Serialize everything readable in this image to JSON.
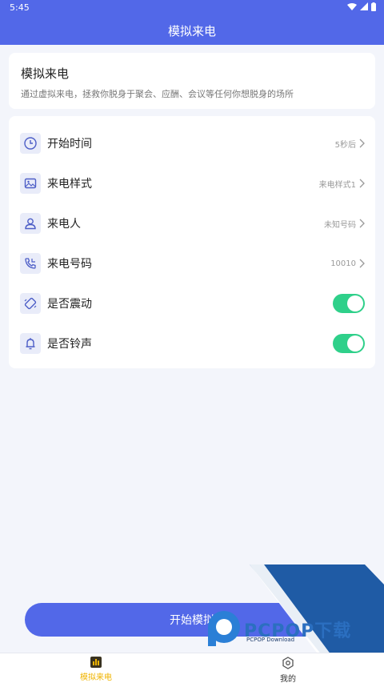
{
  "status_bar": {
    "time": "5:45"
  },
  "header": {
    "title": "模拟来电"
  },
  "intro": {
    "title": "模拟来电",
    "description": "通过虚拟来电，拯救你脱身于聚会、应酬、会议等任何你想脱身的场所"
  },
  "settings": {
    "start_time": {
      "label": "开始时间",
      "value": "5秒后",
      "icon": "clock-icon"
    },
    "call_style": {
      "label": "来电样式",
      "value": "来电样式1",
      "icon": "image-icon"
    },
    "caller": {
      "label": "来电人",
      "value": "未知号码",
      "icon": "person-icon"
    },
    "caller_number": {
      "label": "来电号码",
      "value": "10010",
      "icon": "phone-icon"
    },
    "vibrate": {
      "label": "是否震动",
      "enabled": true,
      "icon": "vibrate-icon"
    },
    "ringtone": {
      "label": "是否铃声",
      "enabled": true,
      "icon": "bell-icon"
    }
  },
  "start_button": {
    "label": "开始模拟"
  },
  "watermark": {
    "text": "PCPOP下载",
    "subtext": "PCPOP Download"
  },
  "tabs": [
    {
      "label": "模拟来电",
      "icon": "chart-icon",
      "active": true
    },
    {
      "label": "我的",
      "icon": "settings-hex-icon",
      "active": false
    }
  ],
  "colors": {
    "primary": "#5268e8",
    "toggle_on": "#2fd08a",
    "tab_active": "#f0b400",
    "background": "#f3f5fb"
  }
}
